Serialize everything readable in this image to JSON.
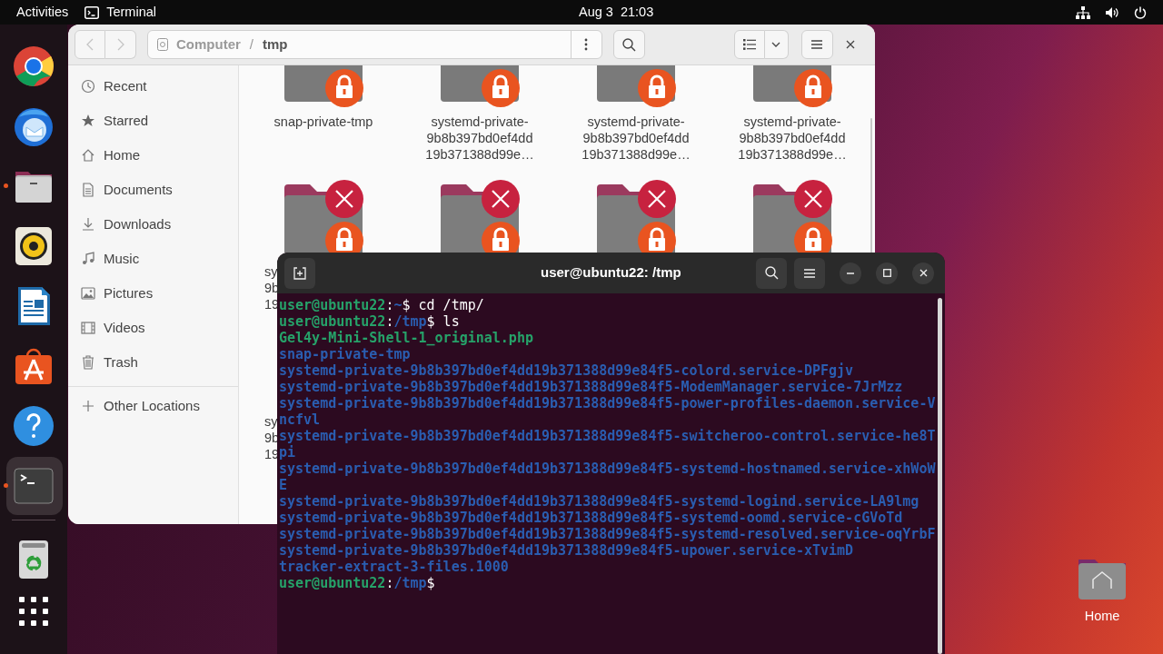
{
  "top_bar": {
    "activities": "Activities",
    "app_name": "Terminal",
    "clock": "Aug 3  21:03"
  },
  "dock": {
    "items": [
      {
        "running": false,
        "focused": false
      },
      {
        "running": false,
        "focused": false
      },
      {
        "running": true,
        "focused": false
      },
      {
        "running": false,
        "focused": false
      },
      {
        "running": false,
        "focused": false
      },
      {
        "running": false,
        "focused": false
      },
      {
        "running": false,
        "focused": false
      },
      {
        "running": true,
        "focused": true
      }
    ]
  },
  "file_manager": {
    "path": [
      "Computer",
      "tmp"
    ],
    "path_separator": "/",
    "back_disabled": true,
    "forward_disabled": true,
    "sidebar": {
      "items": [
        {
          "label": "Recent"
        },
        {
          "label": "Starred"
        },
        {
          "label": "Home"
        },
        {
          "label": "Documents"
        },
        {
          "label": "Downloads"
        },
        {
          "label": "Music"
        },
        {
          "label": "Pictures"
        },
        {
          "label": "Videos"
        },
        {
          "label": "Trash"
        }
      ],
      "other": "Other Locations"
    },
    "files": [
      {
        "kind": "locked",
        "label_lines": [
          "snap-private-tmp"
        ]
      },
      {
        "kind": "locked",
        "label_lines": [
          "systemd-private-",
          "9b8b397bd0ef4dd",
          "19b371388d99e…"
        ]
      },
      {
        "kind": "locked",
        "label_lines": [
          "systemd-private-",
          "9b8b397bd0ef4dd",
          "19b371388d99e…"
        ]
      },
      {
        "kind": "locked",
        "label_lines": [
          "systemd-private-",
          "9b8b397bd0ef4dd",
          "19b371388d99e…"
        ]
      },
      {
        "kind": "blocked",
        "label_lines": [
          "sy",
          "9b",
          "19"
        ]
      },
      {
        "kind": "blocked"
      },
      {
        "kind": "blocked"
      },
      {
        "kind": "blocked"
      },
      {
        "kind": "label_only",
        "label_lines": [
          "sy",
          "9b",
          "19"
        ]
      }
    ]
  },
  "terminal": {
    "title": "user@ubuntu22: /tmp",
    "lines": [
      {
        "kind": "prompt",
        "user": "user@ubuntu22",
        "sep": ":",
        "path": "~",
        "command": "$ cd /tmp/"
      },
      {
        "kind": "prompt",
        "user": "user@ubuntu22",
        "sep": ":",
        "path": "/tmp",
        "command": "$ ls"
      },
      {
        "kind": "output",
        "text": "Gel4y-Mini-Shell-1_original.php",
        "color": "#26a269"
      },
      {
        "kind": "output",
        "text": "snap-private-tmp",
        "color": "#2a5db0"
      },
      {
        "kind": "output",
        "text": "systemd-private-9b8b397bd0ef4dd19b371388d99e84f5-colord.service-DPFgjv",
        "color": "#2a5db0"
      },
      {
        "kind": "output",
        "text": "systemd-private-9b8b397bd0ef4dd19b371388d99e84f5-ModemManager.service-7JrMzz",
        "color": "#2a5db0"
      },
      {
        "kind": "output",
        "text": "systemd-private-9b8b397bd0ef4dd19b371388d99e84f5-power-profiles-daemon.service-Vncfvl",
        "color": "#2a5db0"
      },
      {
        "kind": "output",
        "text": "systemd-private-9b8b397bd0ef4dd19b371388d99e84f5-switcheroo-control.service-he8Tpi",
        "color": "#2a5db0"
      },
      {
        "kind": "output",
        "text": "systemd-private-9b8b397bd0ef4dd19b371388d99e84f5-systemd-hostnamed.service-xhWoWE",
        "color": "#2a5db0"
      },
      {
        "kind": "output",
        "text": "systemd-private-9b8b397bd0ef4dd19b371388d99e84f5-systemd-logind.service-LA9lmg",
        "color": "#2a5db0"
      },
      {
        "kind": "output",
        "text": "systemd-private-9b8b397bd0ef4dd19b371388d99e84f5-systemd-oomd.service-cGVoTd",
        "color": "#2a5db0"
      },
      {
        "kind": "output",
        "text": "systemd-private-9b8b397bd0ef4dd19b371388d99e84f5-systemd-resolved.service-oqYrbF",
        "color": "#2a5db0"
      },
      {
        "kind": "output",
        "text": "systemd-private-9b8b397bd0ef4dd19b371388d99e84f5-upower.service-xTvimD",
        "color": "#2a5db0"
      },
      {
        "kind": "output",
        "text": "tracker-extract-3-files.1000",
        "color": "#2a5db0"
      },
      {
        "kind": "prompt",
        "user": "user@ubuntu22",
        "sep": ":",
        "path": "/tmp",
        "command": "$"
      }
    ]
  },
  "desktop_icons": [
    {
      "label": "Home"
    }
  ]
}
